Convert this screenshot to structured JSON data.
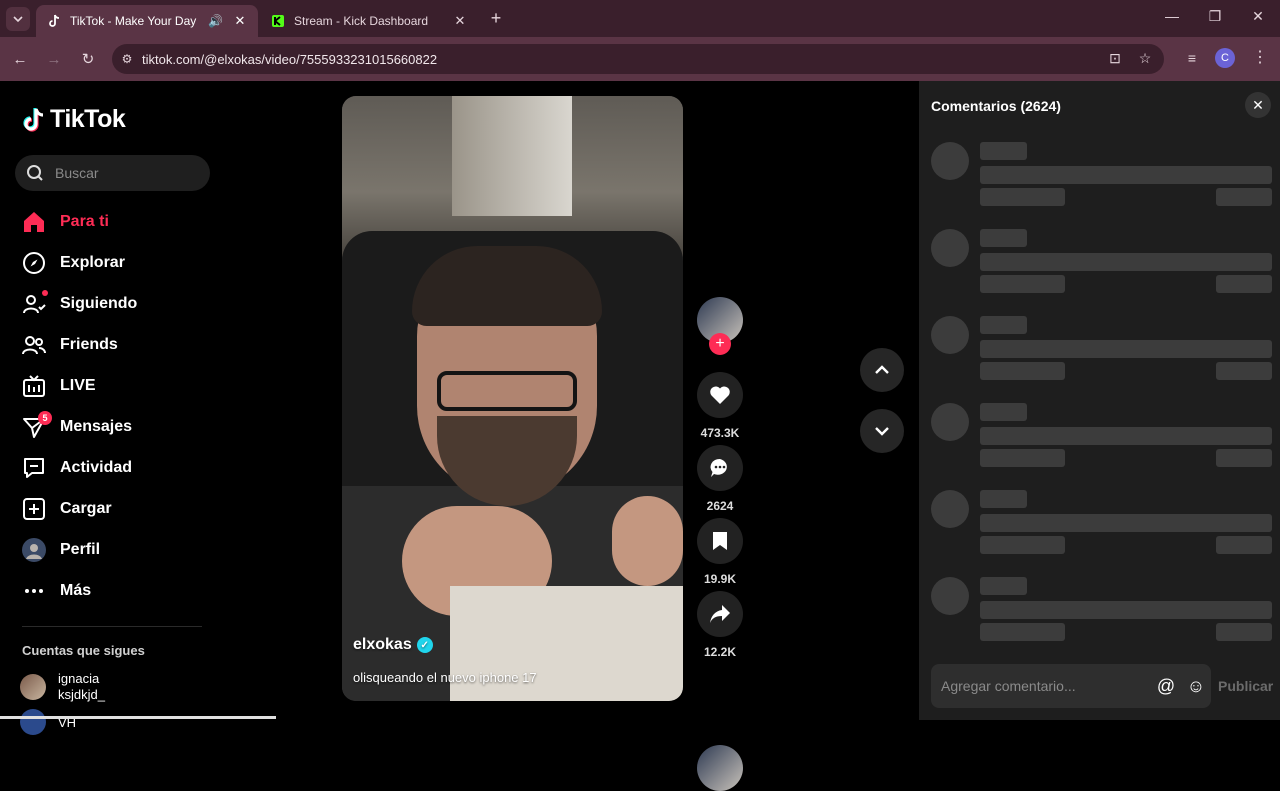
{
  "browser": {
    "tabs": [
      {
        "title": "TikTok - Make Your Day",
        "active": true,
        "favicon": "tiktok-icon",
        "audio": true
      },
      {
        "title": "Stream - Kick Dashboard",
        "active": false,
        "favicon": "kick-icon"
      }
    ],
    "url": "tiktok.com/@elxokas/video/7555933231015660822",
    "profile_initial": "C"
  },
  "sidebar": {
    "logo": "TikTok",
    "search_placeholder": "Buscar",
    "nav": [
      {
        "label": "Para ti",
        "icon": "home-icon",
        "active": true
      },
      {
        "label": "Explorar",
        "icon": "compass-icon"
      },
      {
        "label": "Siguiendo",
        "icon": "following-icon",
        "dot": true
      },
      {
        "label": "Friends",
        "icon": "friends-icon"
      },
      {
        "label": "LIVE",
        "icon": "live-icon"
      },
      {
        "label": "Mensajes",
        "icon": "messages-icon",
        "badge": "5"
      },
      {
        "label": "Actividad",
        "icon": "activity-icon"
      },
      {
        "label": "Cargar",
        "icon": "upload-icon"
      },
      {
        "label": "Perfil",
        "icon": "profile-avatar"
      },
      {
        "label": "Más",
        "icon": "more-icon"
      }
    ],
    "following_title": "Cuentas que sigues",
    "following": [
      {
        "name": "ignacia",
        "handle": "ksjdkjd_"
      },
      {
        "name": "VH",
        "handle": ""
      }
    ]
  },
  "video": {
    "creator": "elxokas",
    "caption": "olisqueando el nuevo iphone 17"
  },
  "actions": {
    "likes": "473.3K",
    "comments": "2624",
    "saves": "19.9K",
    "shares": "12.2K"
  },
  "comments_panel": {
    "title": "Comentarios (2624)",
    "input_placeholder": "Agregar comentario...",
    "post_label": "Publicar"
  },
  "colors": {
    "accent": "#fe2c55",
    "verified": "#20d5ec",
    "chrome_title": "#3a1f2c",
    "chrome_toolbar": "#5a3445"
  }
}
